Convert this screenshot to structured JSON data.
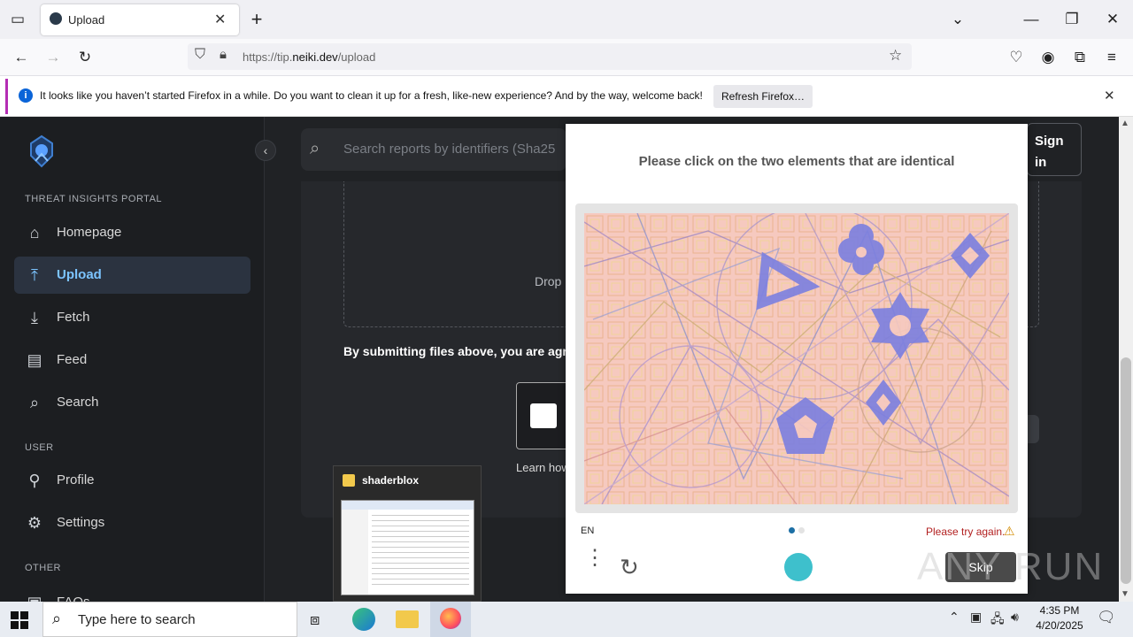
{
  "browser": {
    "tab_title": "Upload",
    "url_prefix": "https://tip.",
    "url_domain": "neiki.dev",
    "url_path": "/upload",
    "notification": "It looks like you haven’t started Firefox in a while. Do you want to clean it up for a fresh, like-new experience? And by the way, welcome back!",
    "refresh_button": "Refresh Firefox…"
  },
  "sidebar": {
    "portal_label": "THREAT INSIGHTS PORTAL",
    "items": [
      {
        "label": "Homepage",
        "icon": "home-icon"
      },
      {
        "label": "Upload",
        "icon": "upload-icon"
      },
      {
        "label": "Fetch",
        "icon": "fetch-icon"
      },
      {
        "label": "Feed",
        "icon": "feed-icon"
      },
      {
        "label": "Search",
        "icon": "search-icon"
      }
    ],
    "user_label": "USER",
    "user_items": [
      {
        "label": "Profile",
        "icon": "profile-icon"
      },
      {
        "label": "Settings",
        "icon": "gear-icon"
      }
    ],
    "other_label": "OTHER",
    "other_items": [
      {
        "label": "FAQs"
      }
    ]
  },
  "main": {
    "search_placeholder": "Search reports by identifiers (Sha25",
    "signin_label_1": "Sign",
    "signin_label_2": "in",
    "drop_text": "Drop",
    "terms_text": "By submitting files above, you are agre",
    "learn_text": "Learn how"
  },
  "captcha": {
    "prompt": "Please click on the two elements that are identical",
    "language": "EN",
    "error": "Please try again.",
    "skip_label": "Skip",
    "accent": "#7b7fe0"
  },
  "popup": {
    "title": "shaderblox"
  },
  "taskbar": {
    "search_placeholder": "Type here to search",
    "time": "4:35 PM",
    "date": "4/20/2025"
  },
  "watermark": "ANY RUN"
}
